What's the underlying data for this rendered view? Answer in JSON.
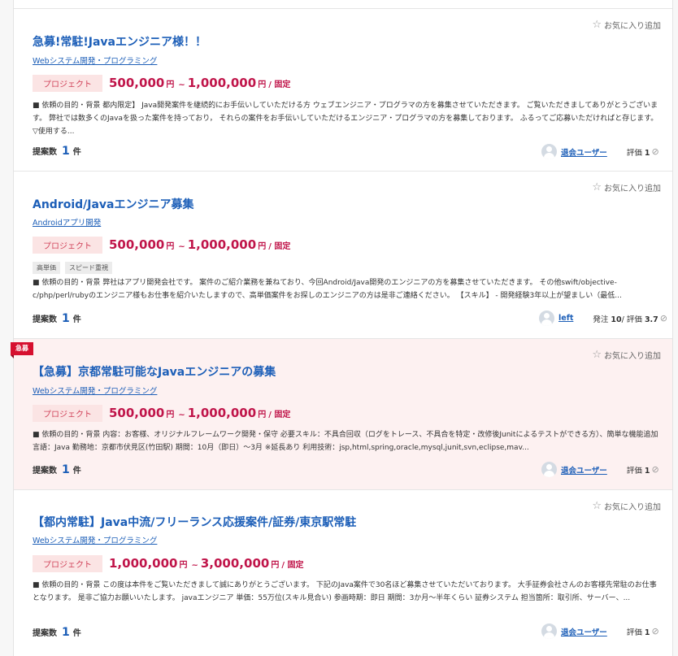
{
  "jobs": [
    {
      "favorite_label": "お気に入り追加",
      "urgent": false,
      "title": "急募!常駐!Javaエンジニア様！！",
      "category": "Webシステム開発・プログラミング",
      "badge": "プロジェクト",
      "price_min": "500,000",
      "price_max": "1,000,000",
      "unit": "円",
      "range_sep": "~",
      "price_type": "/ 固定",
      "tags": [],
      "description": "■ 依頼の目的・背景 都内限定】 Java開発案件を継続的にお手伝いしていただける方 ウェブエンジニア・プログラマの方を募集させていただきます。 ご覧いただきましてありがとうございます。 弊社では数多くのJavaを扱った案件を持っており， それらの案件をお手伝いしていただけるエンジニア・プログラマの方を募集しております。 ふるってご応募いただければと存じます。 ▽使用する...",
      "proposals_label": "提案数",
      "proposals_count": "1",
      "proposals_unit": "件",
      "user_name": "退会ユーザー",
      "orders_label": "",
      "orders_count": "",
      "rating_label": "評価",
      "rating_value": "1"
    },
    {
      "favorite_label": "お気に入り追加",
      "urgent": false,
      "title": "Android/Javaエンジニア募集",
      "category": "Androidアプリ開発",
      "badge": "プロジェクト",
      "price_min": "500,000",
      "price_max": "1,000,000",
      "unit": "円",
      "range_sep": "~",
      "price_type": "/ 固定",
      "tags": [
        "高単価",
        "スピード重視"
      ],
      "description": "■ 依頼の目的・背景 弊社はアプリ開発会社です。 案件のご紹介業務を兼ねており、今回Android/Java開発のエンジニアの方を募集させていただきます。 その他swift/objective-c/php/perl/rubyのエンジニア様もお仕事を紹介いたしますので、高単価案件をお探しのエンジニアの方は是非ご連絡ください。 【スキル】 - 開発経験3年以上が望ましい（最低...",
      "proposals_label": "提案数",
      "proposals_count": "1",
      "proposals_unit": "件",
      "user_name": "left",
      "orders_label": "発注",
      "orders_count": "10",
      "rating_label": "評価",
      "rating_value": "3.7"
    },
    {
      "favorite_label": "お気に入り追加",
      "urgent": true,
      "urgent_label": "急募",
      "title": "【急募】京都常駐可能なJavaエンジニアの募集",
      "category": "Webシステム開発・プログラミング",
      "badge": "プロジェクト",
      "price_min": "500,000",
      "price_max": "1,000,000",
      "unit": "円",
      "range_sep": "~",
      "price_type": "/ 固定",
      "tags": [],
      "description": "■ 依頼の目的・背景 内容：お客様、オリジナルフレームワーク開発・保守 必要スキル：不具合回収（ログをトレース、不具合を特定・改修後Junitによるテストができる方）、簡単な機能追加 言語：Java 勤務地：京都市伏見区(竹田駅) 期間：10月（即日）～3月 ※延長あり 利用技術：jsp,html,spring,oracle,mysql,junit,svn,eclipse,mav...",
      "proposals_label": "提案数",
      "proposals_count": "1",
      "proposals_unit": "件",
      "user_name": "退会ユーザー",
      "orders_label": "",
      "orders_count": "",
      "rating_label": "評価",
      "rating_value": "1"
    },
    {
      "favorite_label": "お気に入り追加",
      "urgent": false,
      "title": "【都内常駐】Java中流/フリーランス応援案件/証券/東京駅常駐",
      "category": "Webシステム開発・プログラミング",
      "badge": "プロジェクト",
      "price_min": "1,000,000",
      "price_max": "3,000,000",
      "unit": "円",
      "range_sep": "~",
      "price_type": "/ 固定",
      "tags": [],
      "description": "■ 依頼の目的・背景 この度は本件をご覧いただきまして誠にありがとうございます。 下記のJava案件で30名ほど募集させていただいております。 大手証券会社さんのお客様先常駐のお仕事となります。 是非ご協力お願いいたします。 javaエンジニア 単価：55万位(スキル見合い) 参画時期：即日 期間：3か月〜半年くらい 証券システム 担当箇所：取引所、サーバー、...",
      "proposals_label": "提案数",
      "proposals_count": "1",
      "proposals_unit": "件",
      "user_name": "退会ユーザー",
      "orders_label": "",
      "orders_count": "",
      "rating_label": "評価",
      "rating_value": "1"
    }
  ]
}
